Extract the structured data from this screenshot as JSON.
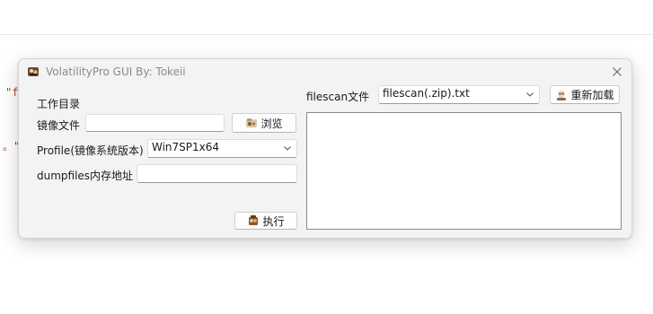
{
  "background": {
    "fragment_1": "\"f",
    "fragment_2": "。\""
  },
  "window": {
    "title": "VolatilityPro GUI By: Tokeii",
    "close_icon": "close-icon"
  },
  "left_panel": {
    "section_label": "工作目录",
    "image_file_label": "镜像文件",
    "image_file_value": "",
    "browse_button": "浏览",
    "profile_label": "Profile(镜像系统版本)",
    "profile_value": "Win7SP1x64",
    "dumpfiles_label": "dumpfiles内存地址",
    "dumpfiles_value": "",
    "execute_button": "执行"
  },
  "right_panel": {
    "filescan_label": "filescan文件",
    "filescan_value": "filescan(.zip).txt",
    "reload_button": "重新加载",
    "output_items": []
  },
  "colors": {
    "window_bg": "#f3f3f3",
    "accent_red": "#c0392b"
  }
}
